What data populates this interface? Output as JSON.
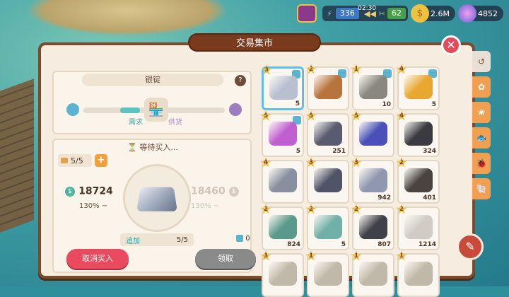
{
  "hud": {
    "energy": "336",
    "timer": "02:30",
    "tools": "62",
    "coins": "2.6M",
    "gems": "4852"
  },
  "title": "交易集市",
  "item_panel": {
    "name": "银锭",
    "demand_label": "需求",
    "supply_label": "供货"
  },
  "order_panel": {
    "status": "等待买入...",
    "slots": "5/5",
    "buy_price": "18724",
    "buy_pct": "130% −",
    "sell_price": "18460",
    "sell_pct": "130% −",
    "add_label": "追加",
    "add_value": "5/5",
    "cube_count": "0",
    "cancel_label": "取消买入",
    "collect_label": "领取"
  },
  "grid": [
    {
      "stars": "3",
      "qty": "5",
      "color": "#b8c0d0",
      "selected": true,
      "cube": true
    },
    {
      "stars": "2",
      "qty": "",
      "color": "#b8743c",
      "selected": false,
      "cube": true
    },
    {
      "stars": "1",
      "qty": "10",
      "color": "#8a8680",
      "selected": false,
      "cube": true
    },
    {
      "stars": "4",
      "qty": "5",
      "color": "#e8a830",
      "selected": false,
      "cube": true
    },
    {
      "stars": "5",
      "qty": "5",
      "color": "#c060d0",
      "selected": false,
      "cube": true
    },
    {
      "stars": "5",
      "qty": "251",
      "color": "#5a5a70",
      "selected": false,
      "cube": false
    },
    {
      "stars": "5",
      "qty": "",
      "color": "#4a50b8",
      "selected": false,
      "cube": false
    },
    {
      "stars": "4",
      "qty": "324",
      "color": "#3a3a40",
      "selected": false,
      "cube": false
    },
    {
      "stars": "4",
      "qty": "",
      "color": "#8890a0",
      "selected": false,
      "cube": false
    },
    {
      "stars": "3",
      "qty": "",
      "color": "#505468",
      "selected": false,
      "cube": false
    },
    {
      "stars": "3",
      "qty": "942",
      "color": "#9098b0",
      "selected": false,
      "cube": false
    },
    {
      "stars": "2",
      "qty": "401",
      "color": "#4a4440",
      "selected": false,
      "cube": false
    },
    {
      "stars": "2",
      "qty": "824",
      "color": "#5a9a8a",
      "selected": false,
      "cube": false
    },
    {
      "stars": "2",
      "qty": "5",
      "color": "#70b0a8",
      "selected": false,
      "cube": false
    },
    {
      "stars": "2",
      "qty": "807",
      "color": "#404048",
      "selected": false,
      "cube": false
    },
    {
      "stars": "2",
      "qty": "1214",
      "color": "#d0ccc4",
      "selected": false,
      "cube": false
    },
    {
      "stars": "3",
      "qty": "",
      "color": "#c0b8a8",
      "selected": false,
      "cube": false
    },
    {
      "stars": "1",
      "qty": "",
      "color": "#c0b8a8",
      "selected": false,
      "cube": false
    },
    {
      "stars": "1",
      "qty": "",
      "color": "#c0b8a8",
      "selected": false,
      "cube": false
    },
    {
      "stars": "1",
      "qty": "",
      "color": "#c0b8a8",
      "selected": false,
      "cube": false
    }
  ],
  "tabs": [
    "history-icon",
    "lotus-icon",
    "flower-icon",
    "fish-icon",
    "bug-icon",
    "shell-icon"
  ]
}
